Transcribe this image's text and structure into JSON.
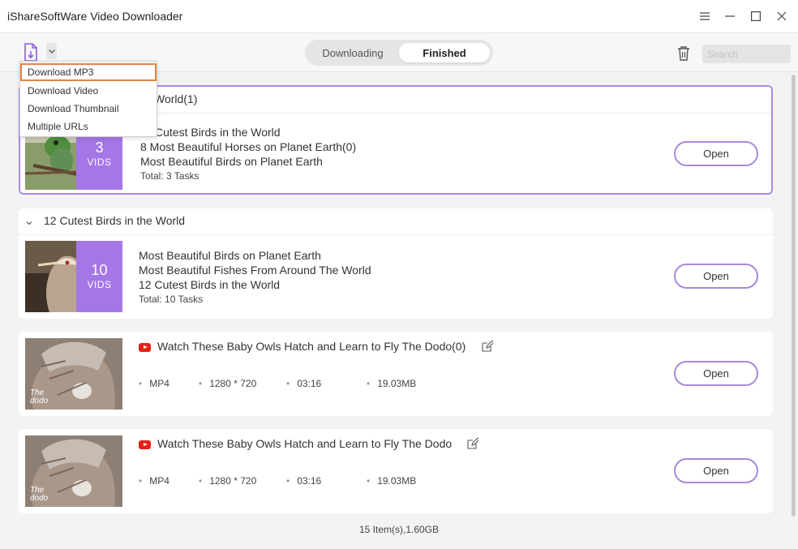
{
  "app": {
    "title": "iShareSoftWare Video Downloader"
  },
  "window_controls": {
    "menu_icon": "hamburger-icon",
    "minimize_icon": "minimize-icon",
    "maximize_icon": "maximize-icon",
    "close_icon": "close-icon"
  },
  "toolbar": {
    "add_icon": "add-file-icon",
    "tabs": [
      {
        "label": "Downloading",
        "active": false
      },
      {
        "label": "Finished",
        "active": true
      }
    ],
    "search_placeholder": "Search",
    "accent_color": "#a576e6"
  },
  "dropdown": {
    "items": [
      {
        "label": "Download MP3",
        "active": true
      },
      {
        "label": "Download Video"
      },
      {
        "label": "Download Thumbnail"
      },
      {
        "label": "Multiple URLs"
      }
    ]
  },
  "groups": [
    {
      "title": "World(1)",
      "count": "3",
      "count_label": "VIDS",
      "lines": [
        "Cutest Birds in the World",
        "8 Most Beautiful Horses on Planet Earth(0)",
        "Most Beautiful Birds on Planet Earth"
      ],
      "total": "Total: 3 Tasks",
      "open_label": "Open"
    },
    {
      "title": "12 Cutest Birds in the World",
      "count": "10",
      "count_label": "VIDS",
      "lines": [
        "Most Beautiful Birds on Planet Earth",
        "Most Beautiful Fishes From Around The World",
        "12 Cutest Birds in the World"
      ],
      "total": "Total: 10 Tasks",
      "open_label": "Open"
    }
  ],
  "videos": [
    {
      "title": "Watch These Baby Owls Hatch and Learn to Fly  The Dodo(0)",
      "format": "MP4",
      "resolution": "1280 * 720",
      "duration": "03:16",
      "size": "19.03MB",
      "open_label": "Open",
      "watermark": "The dodo"
    },
    {
      "title": "Watch These Baby Owls Hatch and Learn to Fly  The Dodo",
      "format": "MP4",
      "resolution": "1280 * 720",
      "duration": "03:16",
      "size": "19.03MB",
      "open_label": "Open",
      "watermark": "The dodo"
    }
  ],
  "status": {
    "summary": "15 Item(s),1.60GB"
  }
}
